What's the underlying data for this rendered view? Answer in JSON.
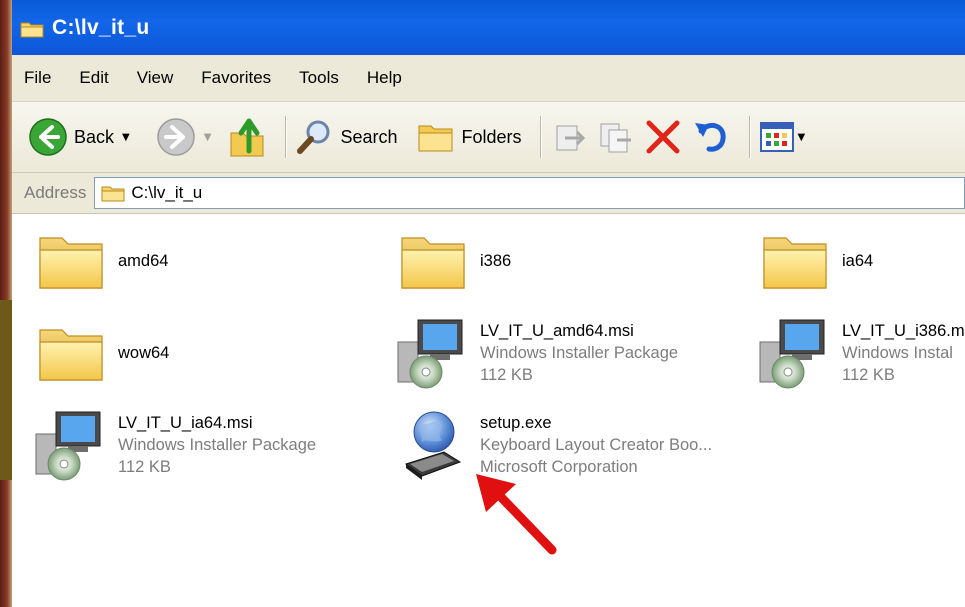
{
  "window": {
    "title": "C:\\lv_it_u"
  },
  "menu": [
    "File",
    "Edit",
    "View",
    "Favorites",
    "Tools",
    "Help"
  ],
  "toolbar": {
    "back_label": "Back",
    "search_label": "Search",
    "folders_label": "Folders"
  },
  "address": {
    "label": "Address",
    "path": "C:\\lv_it_u"
  },
  "files": [
    {
      "name": "amd64",
      "icon": "folder-icon"
    },
    {
      "name": "i386",
      "icon": "folder-icon"
    },
    {
      "name": "ia64",
      "icon": "folder-icon"
    },
    {
      "name": "wow64",
      "icon": "folder-icon"
    },
    {
      "name": "LV_IT_U_amd64.msi",
      "type": "Windows Installer Package",
      "size": "112 KB",
      "icon": "msi-installer-icon"
    },
    {
      "name": "LV_IT_U_i386.m",
      "type": "Windows Instal",
      "size": "112 KB",
      "icon": "msi-installer-icon"
    },
    {
      "name": "LV_IT_U_ia64.msi",
      "type": "Windows Installer Package",
      "size": "112 KB",
      "icon": "msi-installer-icon"
    },
    {
      "name": "setup.exe",
      "type": "Keyboard Layout Creator Boo...",
      "size": "Microsoft Corporation",
      "icon": "setup-globe-icon"
    }
  ],
  "colors": {
    "titlebar": "#0a5ad6",
    "menubar": "#ece9d8",
    "annotation_arrow": "#e01010"
  }
}
